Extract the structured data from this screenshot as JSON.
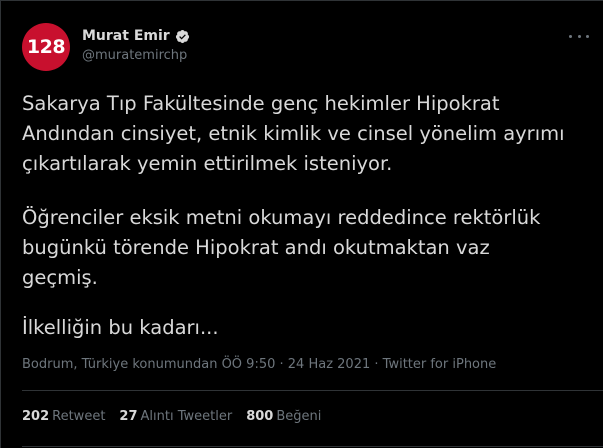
{
  "author": {
    "avatar_text": "128",
    "display_name": "Murat Emir",
    "handle": "@muratemirchp",
    "verified": true,
    "avatar_color": "#c8102e"
  },
  "tweet": {
    "paragraph1": [
      "Sakarya Tıp Fakültesinde genç hekimler Hipokrat",
      "Andından cinsiyet, etnik kimlik ve cinsel yönelim ayrımı",
      "çıkartılarak yemin ettirilmek isteniyor."
    ],
    "paragraph2": [
      "Öğrenciler eksik metni okumayı reddedince rektörlük",
      "bugünkü törende Hipokrat andı okutmaktan vaz",
      "geçmiş."
    ],
    "paragraph3": [
      "İlkelliğin bu kadarı..."
    ]
  },
  "meta": {
    "location_time": "Bodrum, Türkiye konumundan ÖÖ 9:50",
    "sep1": " · ",
    "date": "24 Haz 2021",
    "sep2": " · ",
    "source": "Twitter for iPhone"
  },
  "stats": {
    "retweets_count": "202",
    "retweets_label": "Retweet",
    "quotes_count": "27",
    "quotes_label": "Alıntı Tweetler",
    "likes_count": "800",
    "likes_label": "Beğeni"
  },
  "colors": {
    "background": "#000000",
    "text": "#d9d9d9",
    "muted": "#6e767d",
    "border": "#2f3336",
    "verified_badge": "#d9d9d9"
  },
  "icons": {
    "verified": "verified-badge-icon",
    "more": "more-options-icon"
  }
}
